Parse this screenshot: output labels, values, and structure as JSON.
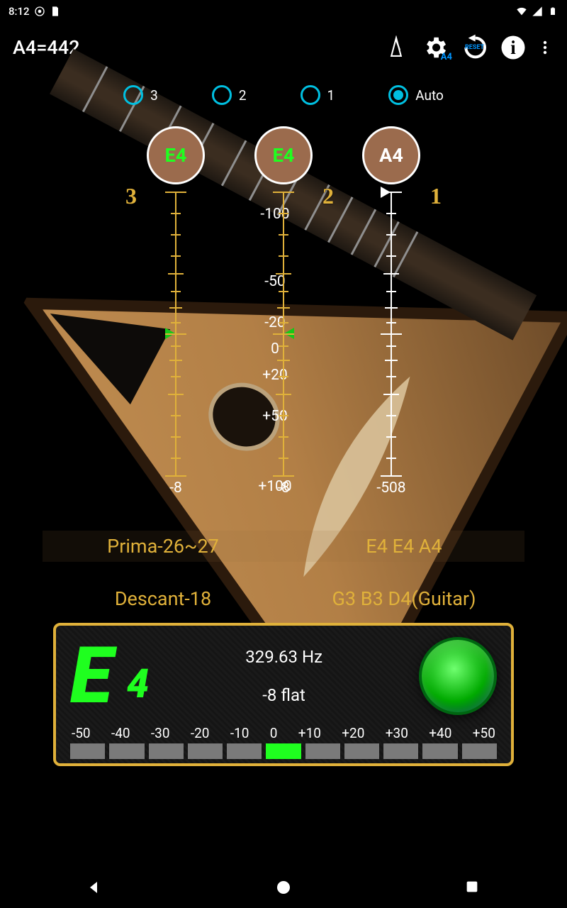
{
  "status": {
    "time": "8:12"
  },
  "header": {
    "title": "A4=442"
  },
  "toolbar": {
    "metronome_icon": "metronome-icon",
    "tune_a4": "A4",
    "reset_label": "RESET",
    "info_icon": "info-icon",
    "menu_icon": "overflow-menu-icon"
  },
  "radios": {
    "items": [
      {
        "label": "3",
        "selected": false
      },
      {
        "label": "2",
        "selected": false
      },
      {
        "label": "1",
        "selected": false
      },
      {
        "label": "Auto",
        "selected": true
      }
    ]
  },
  "strings": {
    "cols": [
      {
        "note": "E4",
        "num": "3",
        "cents": "-8",
        "color": "green"
      },
      {
        "note": "E4",
        "num": "2",
        "cents": "-8",
        "color": "green"
      },
      {
        "note": "A4",
        "num": "1",
        "cents": "-508",
        "color": "white"
      }
    ],
    "scale": {
      "top": "-100",
      "m50": "-50",
      "m20": "-20",
      "z": "0",
      "p20": "+20",
      "p50": "+50",
      "bot": "+100"
    }
  },
  "presets": {
    "a": "Prima-26~27",
    "b": "E4 E4 A4",
    "c": "Descant-18",
    "d": "G3 B3 D4(Guitar)"
  },
  "meter": {
    "note": "E",
    "octave": "4",
    "freq": "329.63 Hz",
    "flat": "-8 flat",
    "centLabels": [
      "-50",
      "-40",
      "-30",
      "-20",
      "-10",
      "0",
      "+10",
      "+20",
      "+30",
      "+40",
      "+50"
    ],
    "active_index": 5
  }
}
